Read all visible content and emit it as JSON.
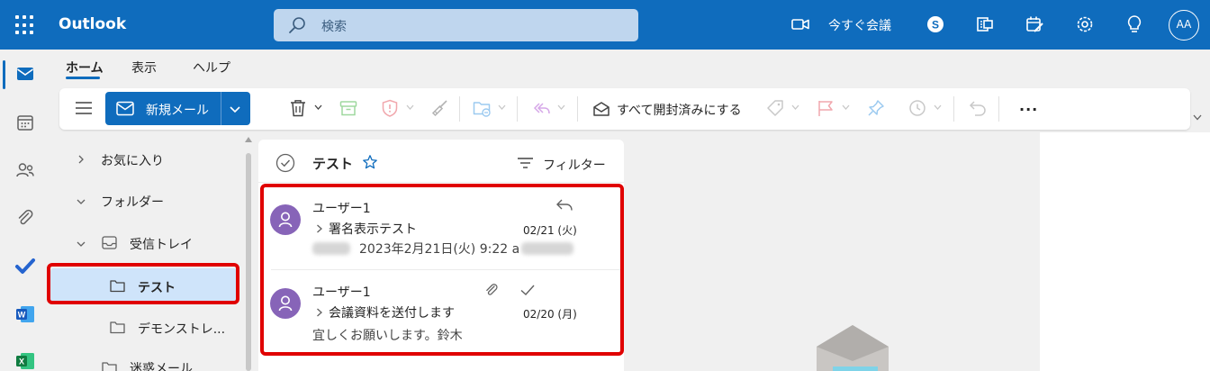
{
  "app": {
    "title": "Outlook"
  },
  "search": {
    "placeholder": "検索"
  },
  "topbar": {
    "meet_now": "今すぐ会議",
    "avatar_initials": "AA"
  },
  "tabs": [
    {
      "label": "ホーム",
      "active": true
    },
    {
      "label": "表示",
      "active": false
    },
    {
      "label": "ヘルプ",
      "active": false
    }
  ],
  "ribbon": {
    "new_mail": "新規メール",
    "mark_all_read": "すべて開封済みにする",
    "more": "···"
  },
  "folders": {
    "favorites": "お気に入り",
    "folders": "フォルダー",
    "inbox": "受信トレイ",
    "test": "テスト",
    "demo": "デモンストレ...",
    "junk": "迷惑メール"
  },
  "list": {
    "title": "テスト",
    "filter": "フィルター",
    "messages": [
      {
        "sender": "ユーザー1",
        "subject": "署名表示テスト",
        "date": "02/21 (火)",
        "preview": "2023年2月21日(火) 9:22",
        "preview_suffix": "a",
        "status": "replied"
      },
      {
        "sender": "ユーザー1",
        "subject": "会議資料を送付します",
        "date": "02/20 (月)",
        "preview": "宜しくお願いします。鈴木",
        "status": "attachment-read"
      }
    ]
  },
  "colors": {
    "brand": "#0f6cbd",
    "avatar": "#8764b8",
    "highlight_box": "#e00000",
    "selected_folder": "#cfe4fa"
  }
}
